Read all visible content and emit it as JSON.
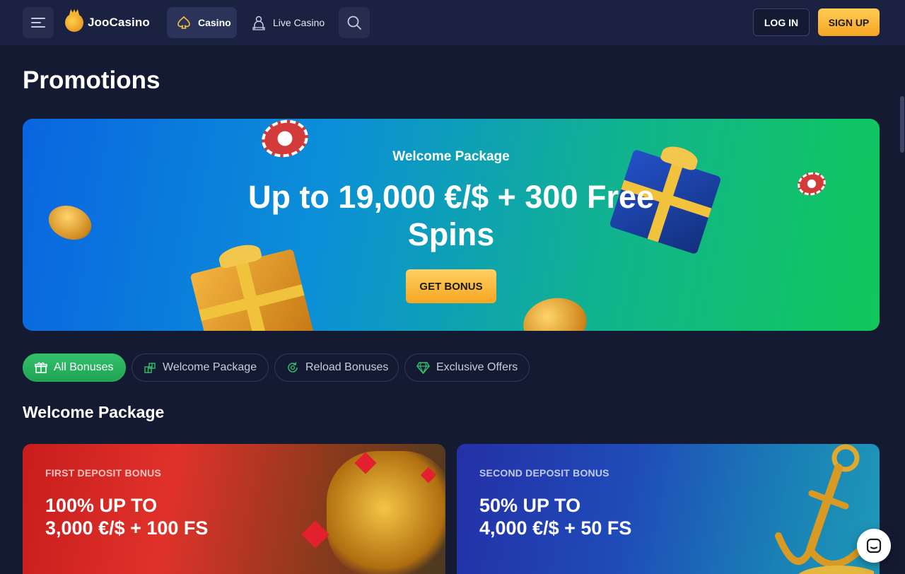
{
  "header": {
    "logo_text": "JooCasino",
    "nav": [
      {
        "label": "Casino",
        "icon": "spade-icon"
      },
      {
        "label": "Live Casino",
        "icon": "dealer-icon"
      }
    ],
    "login_label": "LOG IN",
    "signup_label": "SIGN UP"
  },
  "page": {
    "title": "Promotions"
  },
  "hero": {
    "subtitle": "Welcome Package",
    "title": "Up to 19,000 €/$ + 300 Free Spins",
    "cta_label": "GET BONUS"
  },
  "filters": [
    {
      "label": "All Bonuses",
      "icon": "gift-icon",
      "active": true
    },
    {
      "label": "Welcome Package",
      "icon": "gifts-icon",
      "active": false
    },
    {
      "label": "Reload Bonuses",
      "icon": "reload-icon",
      "active": false
    },
    {
      "label": "Exclusive Offers",
      "icon": "diamond-icon",
      "active": false
    }
  ],
  "section": {
    "title": "Welcome Package"
  },
  "cards": [
    {
      "eyebrow": "FIRST DEPOSIT BONUS",
      "title_line1": "100% UP TO",
      "title_line2": "3,000 €/$ + 100 FS"
    },
    {
      "eyebrow": "SECOND DEPOSIT BONUS",
      "title_line1": "50% UP TO",
      "title_line2": "4,000 €/$ + 50 FS"
    }
  ],
  "colors": {
    "background": "#151a33",
    "header": "#1b2140",
    "accent_yellow": "#f6a623",
    "accent_green": "#2ab862"
  }
}
